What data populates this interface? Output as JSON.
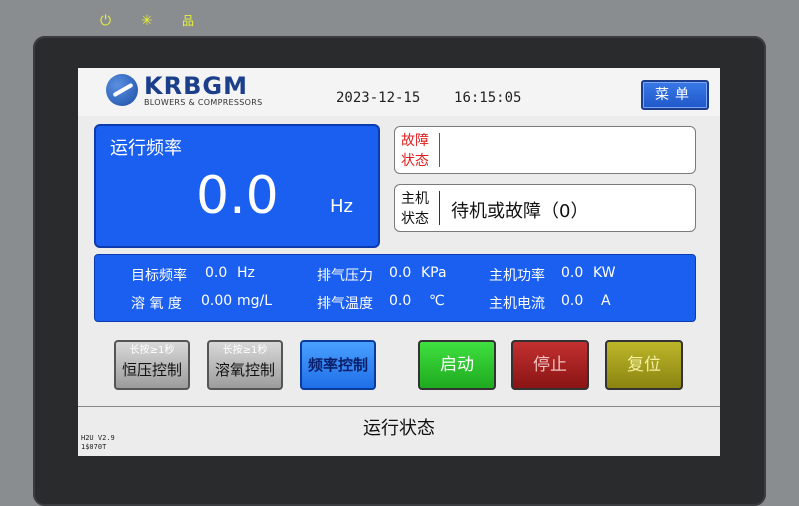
{
  "leds": {
    "power": "⏻",
    "sun": "✳",
    "net": "品"
  },
  "logo": {
    "name": "KRBGM",
    "subtitle": "BLOWERS & COMPRESSORS"
  },
  "header": {
    "date": "2023-12-15",
    "time": "16:15:05",
    "menu_label": "菜单"
  },
  "frequency": {
    "label": "运行频率",
    "value": "0.0",
    "unit": "Hz"
  },
  "fault": {
    "label_line1": "故障",
    "label_line2": "状态",
    "value": ""
  },
  "host": {
    "label_line1": "主机",
    "label_line2": "状态",
    "value": "待机或故障（0）"
  },
  "params": {
    "target_freq": {
      "label": "目标频率",
      "value": "0.0",
      "unit": "Hz"
    },
    "dissolved_oxygen": {
      "label": "溶 氧 度",
      "value": "0.00",
      "unit": "mg/L"
    },
    "exhaust_pressure": {
      "label": "排气压力",
      "value": "0.0",
      "unit": "KPa"
    },
    "exhaust_temp": {
      "label": "排气温度",
      "value": "0.0",
      "unit": "℃"
    },
    "host_power": {
      "label": "主机功率",
      "value": "0.0",
      "unit": "KW"
    },
    "host_current": {
      "label": "主机电流",
      "value": "0.0",
      "unit": "A"
    }
  },
  "buttons": {
    "const_pressure": {
      "hint": "长按≥1秒",
      "label": "恒压控制"
    },
    "do_control": {
      "hint": "长按≥1秒",
      "label": "溶氧控制"
    },
    "freq_control": {
      "label": "频率控制"
    },
    "start": {
      "label": "启动"
    },
    "stop": {
      "label": "停止"
    },
    "reset": {
      "label": "复位"
    }
  },
  "footer": {
    "title": "运行状态",
    "version_line1": "H2U V2.9",
    "version_line2": "1$070T"
  },
  "colors": {
    "panel_blue": "#1a5ff0",
    "fault_red": "#e02020",
    "start_green": "#2fc42f",
    "stop_red": "#a82020",
    "reset_olive": "#a09a1a"
  }
}
